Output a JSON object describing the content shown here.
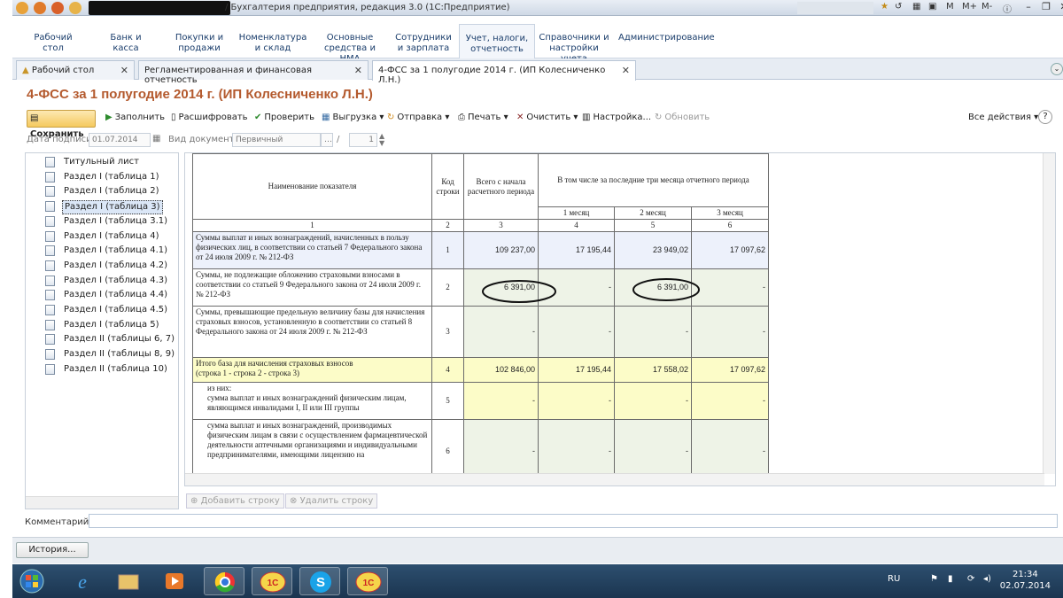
{
  "window": {
    "title": "/ Бухгалтерия предприятия, редакция 3.0  (1С:Предприятие)",
    "right_controls": [
      "M",
      "M+",
      "M-"
    ]
  },
  "sections": [
    {
      "label": "Рабочий\nстол"
    },
    {
      "label": "Банк и\nкасса"
    },
    {
      "label": "Покупки и\nпродажи"
    },
    {
      "label": "Номенклатура\nи склад"
    },
    {
      "label": "Основные\nсредства и НМА"
    },
    {
      "label": "Сотрудники\nи зарплата"
    },
    {
      "label": "Учет, налоги,\nотчетность"
    },
    {
      "label": "Справочники и\nнастройки учета"
    },
    {
      "label": "Администрирование"
    }
  ],
  "tabs": [
    {
      "label": "Рабочий стол"
    },
    {
      "label": "Регламентированная и финансовая отчетность"
    },
    {
      "label": "4-ФСС за 1 полугодие 2014 г. (ИП Колесниченко Л.Н.)"
    }
  ],
  "form": {
    "title": "4-ФСС за 1 полугодие 2014 г. (ИП Колесниченко Л.Н.)"
  },
  "toolbar": {
    "save": "Сохранить",
    "fill": "Заполнить",
    "decode": "Расшифровать",
    "check": "Проверить",
    "export": "Выгрузка",
    "send": "Отправка",
    "print": "Печать",
    "clear": "Очистить",
    "settings": "Настройка...",
    "refresh": "Обновить",
    "all_actions": "Все действия"
  },
  "fields": {
    "sign_date_label": "Дата подписи:",
    "sign_date": "01.07.2014",
    "doc_type_label": "Вид документа:",
    "doc_type": "Первичный",
    "slash": "/",
    "number": "1"
  },
  "tree": [
    {
      "label": "Титульный лист"
    },
    {
      "label": "Раздел I (таблица 1)"
    },
    {
      "label": "Раздел I (таблица 2)"
    },
    {
      "label": "Раздел I (таблица 3)"
    },
    {
      "label": "Раздел I (таблица 3.1)"
    },
    {
      "label": "Раздел I (таблица 4)"
    },
    {
      "label": "Раздел I (таблица 4.1)"
    },
    {
      "label": "Раздел I (таблица 4.2)"
    },
    {
      "label": "Раздел I (таблица 4.3)"
    },
    {
      "label": "Раздел I (таблица 4.4)"
    },
    {
      "label": "Раздел I (таблица 4.5)"
    },
    {
      "label": "Раздел I (таблица 5)"
    },
    {
      "label": "Раздел II (таблицы 6, 7)"
    },
    {
      "label": "Раздел II (таблицы 8, 9)"
    },
    {
      "label": "Раздел II (таблица 10)"
    }
  ],
  "table": {
    "h_name": "Наименование показателя",
    "h_code": "Код строки",
    "h_total": "Всего с начала расчетного периода",
    "h_last3": "В том числе за последние три месяца отчетного периода",
    "h_m1": "1 месяц",
    "h_m2": "2 месяц",
    "h_m3": "3 месяц",
    "colnums": [
      "1",
      "2",
      "3",
      "4",
      "5",
      "6"
    ],
    "rows": [
      {
        "name": "Суммы выплат и иных вознаграждений, начисленных в пользу физических лиц, в соответствии со статьей 7 Федерального закона от 24 июля 2009 г. № 212-ФЗ",
        "code": "1",
        "total": "109 237,00",
        "m1": "17 195,44",
        "m2": "23 949,02",
        "m3": "17 097,62"
      },
      {
        "name": "Суммы, не подлежащие обложению страховыми взносами в соответствии со статьей 9 Федерального закона от 24 июля 2009 г. № 212-ФЗ",
        "code": "2",
        "total": "6 391,00",
        "m1": "-",
        "m2": "6 391,00",
        "m3": "-"
      },
      {
        "name": "Суммы, превышающие предельную величину базы для начисления страховых взносов, установленную в соответствии со статьей 8 Федерального закона от 24 июля 2009 г. № 212-ФЗ",
        "code": "3",
        "total": "-",
        "m1": "-",
        "m2": "-",
        "m3": "-"
      },
      {
        "name": "Итого база для начисления страховых взносов\n(строка 1 - строка 2 - строка 3)",
        "code": "4",
        "total": "102 846,00",
        "m1": "17 195,44",
        "m2": "17 558,02",
        "m3": "17 097,62"
      },
      {
        "name": "из них:\nсумма выплат и иных вознаграждений физическим лицам, являющимся инвалидами I, II или III группы",
        "code": "5",
        "total": "-",
        "m1": "-",
        "m2": "-",
        "m3": "-"
      },
      {
        "name": "сумма выплат и иных вознаграждений, производимых физическим лицам в связи с осуществлением фармацевтической деятельности аптечными организациями и индивидуальными предпринимателями, имеющими лицензию на",
        "code": "6",
        "total": "-",
        "m1": "-",
        "m2": "-",
        "m3": "-"
      }
    ]
  },
  "row_actions": {
    "add": "Добавить строку",
    "delete": "Удалить строку"
  },
  "comment_label": "Комментарий:",
  "history_button": "История...",
  "taskbar": {
    "lang": "RU",
    "time": "21:34",
    "date": "02.07.2014"
  }
}
